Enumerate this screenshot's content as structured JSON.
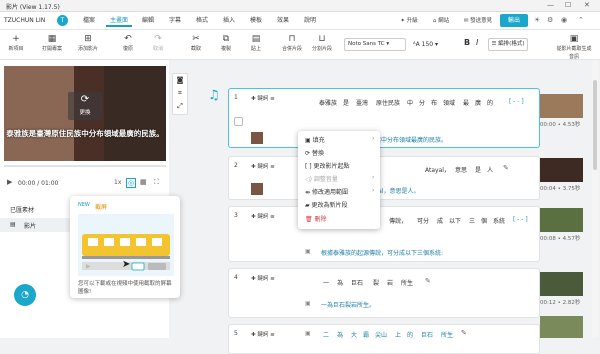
{
  "titlebar": {
    "title": "影片 (View 1.17.5)"
  },
  "menubar": {
    "user": "TZUCHUN LIN",
    "avatar": "T",
    "tabs": [
      {
        "label": "檔案"
      },
      {
        "label": "主畫面"
      },
      {
        "label": "編輯"
      },
      {
        "label": "字幕"
      },
      {
        "label": "格式"
      },
      {
        "label": "插入"
      },
      {
        "label": "模板"
      },
      {
        "label": "效果"
      },
      {
        "label": "說明"
      }
    ],
    "right": [
      {
        "label": "升級"
      },
      {
        "label": "網站"
      },
      {
        "label": "發送意見"
      }
    ],
    "export": "輸出"
  },
  "toolbar": {
    "tools": [
      {
        "icon": "+",
        "label": "新項目"
      },
      {
        "icon": "▦",
        "label": "打開專案"
      },
      {
        "icon": "⊞",
        "label": "添加影片"
      },
      {
        "icon": "↶",
        "label": "復原"
      },
      {
        "icon": "↷",
        "label": "取消"
      },
      {
        "icon": "✂",
        "label": "截取"
      },
      {
        "icon": "⧉",
        "label": "複製"
      },
      {
        "icon": "▤",
        "label": "貼上"
      },
      {
        "icon": "⊓",
        "label": "合併片段"
      },
      {
        "icon": "⊔",
        "label": "分割片段"
      },
      {
        "icon": "▣",
        "label": "從影片截取生成音訊"
      }
    ],
    "font": "Noto Sans TC",
    "size": "150",
    "bold": "B",
    "italic": "I",
    "layout": "☰ 編排(格式)"
  },
  "video": {
    "replace": "更換",
    "subtitle": "泰雅族是臺灣原住民族中分布領域最廣的民族。",
    "time": "00:00 / 01:00",
    "speed": "1x"
  },
  "materials": {
    "section": "已匯素材",
    "item": "影片"
  },
  "tooltip": {
    "badge": "NEW",
    "title": "截屏",
    "desc": "您可以下載或在視頻中使用截取的屏幕圖像!"
  },
  "rows": [
    {
      "num": "1",
      "kw": "鍵詞",
      "words": [
        "泰雅族",
        "是",
        "臺灣",
        "原住民族",
        "中",
        "分",
        "布",
        "領域",
        "最",
        "廣",
        "的"
      ],
      "trans": "泰雅族是臺灣原住民族中分布領域最廣的民族。",
      "dur": "00:00 • 4.53秒"
    },
    {
      "num": "2",
      "kw": "鍵詞",
      "words": [
        "Atayal，",
        "意思",
        "是",
        "人"
      ],
      "trans": "泰雅族的自稱為 atayal，意思是人。",
      "dur": "00:04 • 3.75秒"
    },
    {
      "num": "3",
      "kw": "鍵詞",
      "words": [
        "傳說，",
        "可分",
        "成",
        "以下",
        "三",
        "個",
        "系統"
      ],
      "trans": "根據泰雅族的起源傳說，可分成以下三個系統:",
      "dur": "00:08 • 4.57秒"
    },
    {
      "num": "4",
      "kw": "鍵詞",
      "words": [
        "一",
        "為",
        "巨石",
        "裂",
        "岩",
        "所生"
      ],
      "trans": "一為巨石裂岩所生。",
      "dur": "00:12 • 2.82秒"
    },
    {
      "num": "5",
      "kw": "鍵詞",
      "words": [
        "二",
        "為",
        "大",
        "霸",
        "尖山",
        "上",
        "的",
        "巨石",
        "所生"
      ],
      "trans": "",
      "dur": ""
    }
  ],
  "context_menu": [
    {
      "label": "填充",
      "arrow": "›",
      "disabled": false,
      "danger": false
    },
    {
      "label": "替換",
      "arrow": "",
      "disabled": false,
      "danger": false
    },
    {
      "label": "更改影片起點",
      "arrow": "",
      "disabled": false,
      "danger": false
    },
    {
      "label": "調整音量",
      "arrow": "›",
      "disabled": true,
      "danger": false
    },
    {
      "label": "修改適用範圍",
      "arrow": "›",
      "disabled": false,
      "danger": false
    },
    {
      "label": "更改為新片段",
      "arrow": "",
      "disabled": false,
      "danger": false
    },
    {
      "label": "刪除",
      "arrow": "",
      "disabled": false,
      "danger": true
    }
  ],
  "colors": {
    "accent": "#1aa7c9",
    "danger": "#d33333"
  }
}
